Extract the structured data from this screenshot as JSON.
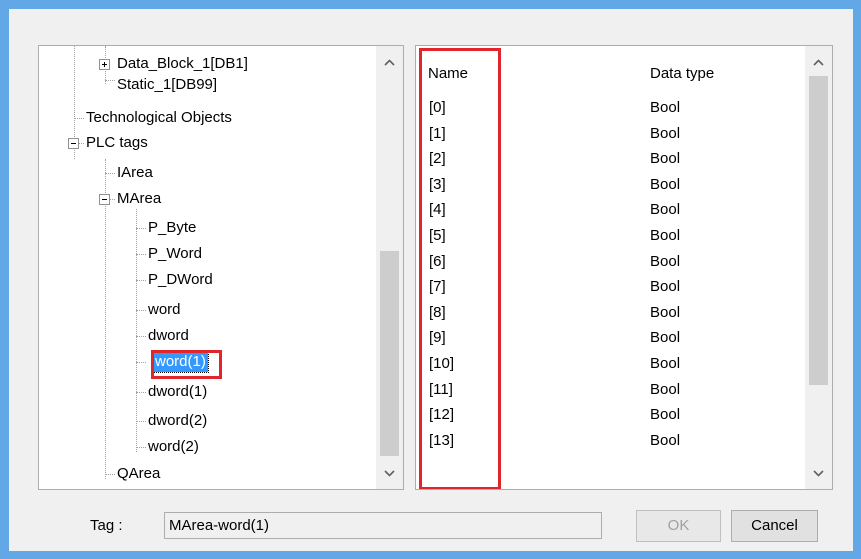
{
  "tree": {
    "items": [
      {
        "label": "Data_Block_1[DB1]"
      },
      {
        "label": "Static_1[DB99]"
      },
      {
        "label": "Technological Objects"
      },
      {
        "label": "PLC tags"
      },
      {
        "label": "IArea"
      },
      {
        "label": "MArea"
      },
      {
        "label": "P_Byte"
      },
      {
        "label": "P_Word"
      },
      {
        "label": "P_DWord"
      },
      {
        "label": "word"
      },
      {
        "label": "dword"
      },
      {
        "label": "word(1)"
      },
      {
        "label": "dword(1)"
      },
      {
        "label": "dword(2)"
      },
      {
        "label": "word(2)"
      },
      {
        "label": "QArea"
      }
    ],
    "selected_index": 11,
    "scroll": {
      "thumb_fraction_start": 0.56,
      "thumb_fraction_size": 0.44
    }
  },
  "table": {
    "headers": {
      "name": "Name",
      "data_type": "Data type"
    },
    "rows": [
      {
        "name": "[0]",
        "type": "Bool"
      },
      {
        "name": "[1]",
        "type": "Bool"
      },
      {
        "name": "[2]",
        "type": "Bool"
      },
      {
        "name": "[3]",
        "type": "Bool"
      },
      {
        "name": "[4]",
        "type": "Bool"
      },
      {
        "name": "[5]",
        "type": "Bool"
      },
      {
        "name": "[6]",
        "type": "Bool"
      },
      {
        "name": "[7]",
        "type": "Bool"
      },
      {
        "name": "[8]",
        "type": "Bool"
      },
      {
        "name": "[9]",
        "type": "Bool"
      },
      {
        "name": "[10]",
        "type": "Bool"
      },
      {
        "name": "[11]",
        "type": "Bool"
      },
      {
        "name": "[12]",
        "type": "Bool"
      },
      {
        "name": "[13]",
        "type": "Bool"
      }
    ],
    "scroll": {
      "thumb_fraction_start": 0.0,
      "thumb_fraction_size": 0.76
    }
  },
  "footer": {
    "tag_label": "Tag :",
    "tag_value": "MArea-word(1)",
    "ok_label": "OK",
    "cancel_label": "Cancel"
  },
  "colors": {
    "frame": "#62a7e6",
    "highlight_box": "#e0262a",
    "selection": "#3399ff"
  }
}
